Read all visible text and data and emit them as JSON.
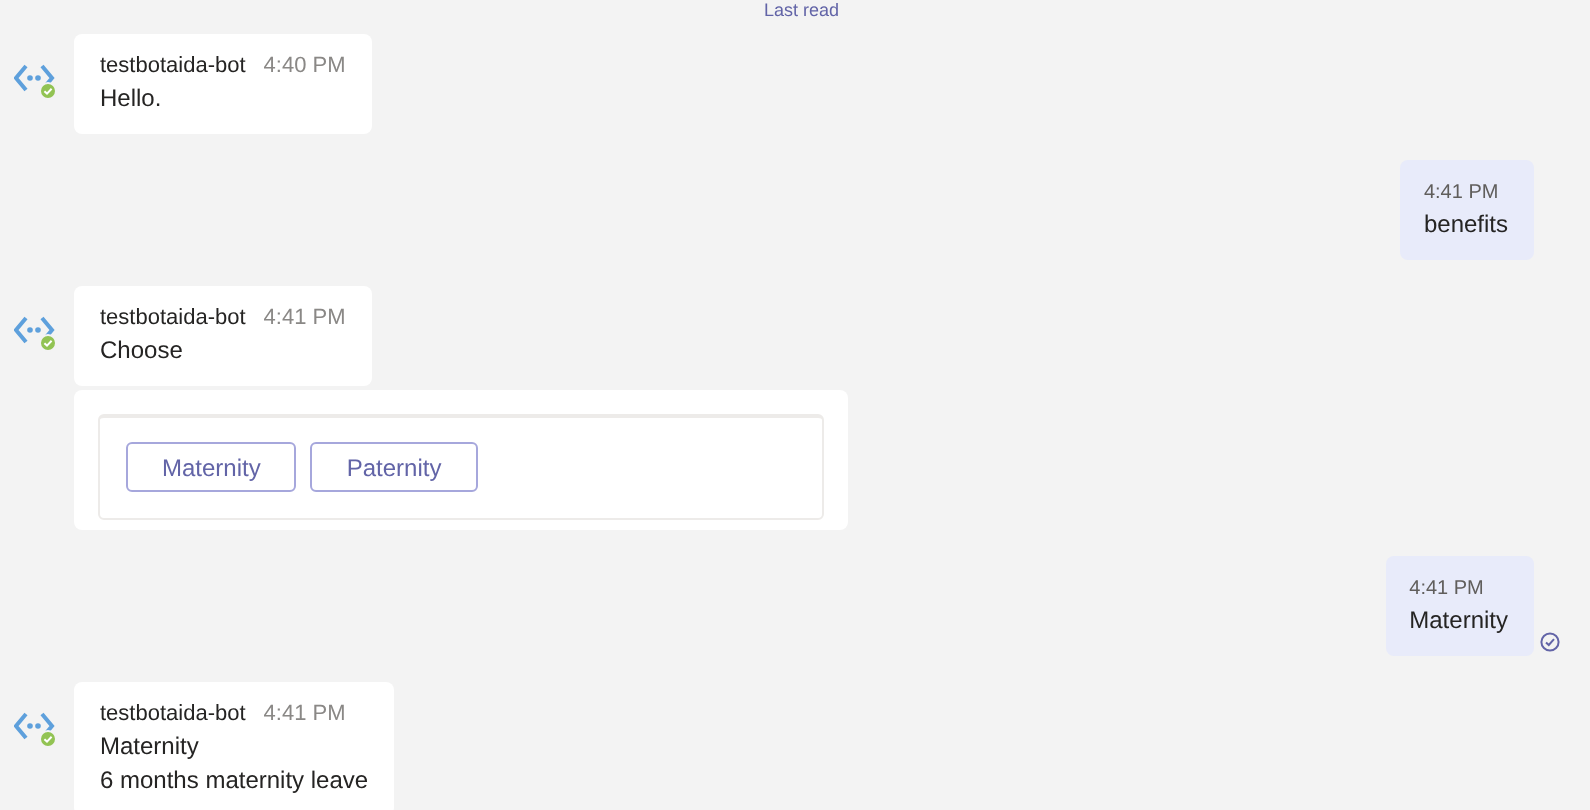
{
  "last_read": "Last read",
  "messages": [
    {
      "kind": "bot",
      "sender": "testbotaida-bot",
      "time": "4:40 PM",
      "lines": [
        "Hello."
      ]
    },
    {
      "kind": "me",
      "time": "4:41 PM",
      "lines": [
        "benefits"
      ],
      "seen": false
    },
    {
      "kind": "bot",
      "sender": "testbotaida-bot",
      "time": "4:41 PM",
      "lines": [
        "Choose"
      ],
      "card_buttons": [
        "Maternity",
        "Paternity"
      ]
    },
    {
      "kind": "me",
      "time": "4:41 PM",
      "lines": [
        "Maternity"
      ],
      "seen": true
    },
    {
      "kind": "bot",
      "sender": "testbotaida-bot",
      "time": "4:41 PM",
      "lines": [
        "Maternity",
        "6 months maternity leave"
      ]
    }
  ]
}
